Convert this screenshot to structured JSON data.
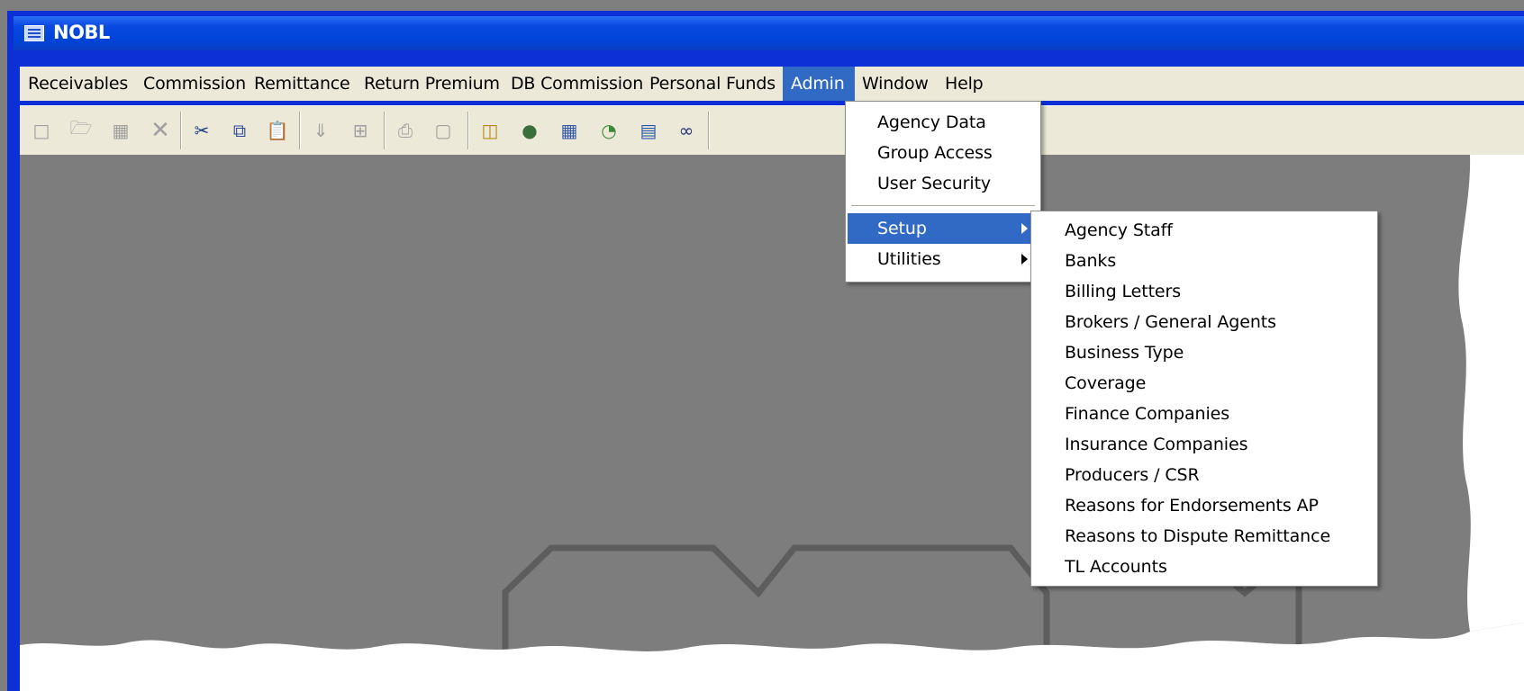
{
  "window": {
    "title": "NOBL"
  },
  "menubar": {
    "items": [
      {
        "label": "Receivables"
      },
      {
        "label": "Commission"
      },
      {
        "label": "Remittance"
      },
      {
        "label": "Return Premium"
      },
      {
        "label": "DB Commission"
      },
      {
        "label": "Personal Funds"
      },
      {
        "label": "Admin",
        "active": true
      },
      {
        "label": "Window"
      },
      {
        "label": "Help"
      }
    ]
  },
  "toolbar": {
    "icons": [
      "new-icon",
      "open-icon",
      "save-icon",
      "delete-icon",
      "cut-icon",
      "copy-icon",
      "paste-icon",
      "move-down-icon",
      "import-icon",
      "print-icon",
      "print-preview-icon",
      "report-icon",
      "users-icon",
      "calculator-icon",
      "pie-chart-icon",
      "list-icon",
      "find-icon"
    ]
  },
  "admin_menu": {
    "items": [
      {
        "label": "Agency Data"
      },
      {
        "label": "Group Access"
      },
      {
        "label": "User Security"
      },
      {
        "label": "Setup",
        "submenu": true,
        "highlighted": true
      },
      {
        "label": "Utilities",
        "submenu": true
      }
    ]
  },
  "setup_submenu": {
    "items": [
      {
        "label": "Agency Staff"
      },
      {
        "label": "Banks"
      },
      {
        "label": "Billing Letters"
      },
      {
        "label": "Brokers / General Agents"
      },
      {
        "label": "Business Type"
      },
      {
        "label": "Coverage"
      },
      {
        "label": "Finance Companies"
      },
      {
        "label": "Insurance Companies"
      },
      {
        "label": "Producers / CSR"
      },
      {
        "label": "Reasons for Endorsements AP"
      },
      {
        "label": "Reasons to Dispute Remittance"
      },
      {
        "label": "TL Accounts"
      }
    ]
  },
  "colors": {
    "title_bar": "#0044d8",
    "menu_highlight": "#316ac5",
    "client_area": "#7d7d7d",
    "menubar_bg": "#ece9d8"
  }
}
